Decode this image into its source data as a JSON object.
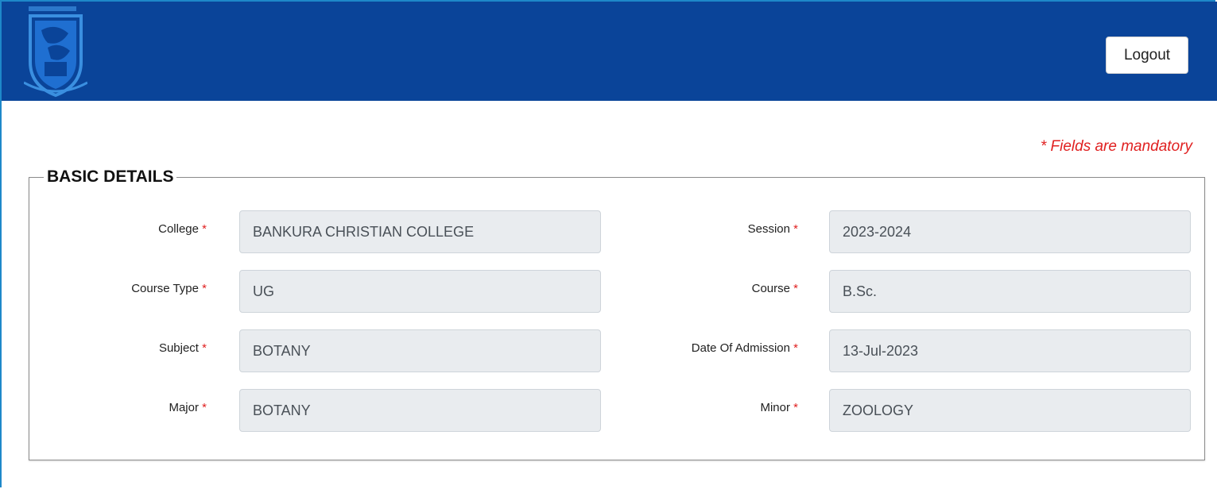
{
  "header": {
    "logout_label": "Logout",
    "bg_color": "#0a4499"
  },
  "mandatory_note": "* Fields are mandatory",
  "section": {
    "title": "BASIC DETAILS"
  },
  "fields": {
    "college": {
      "label": "College",
      "value": "BANKURA CHRISTIAN COLLEGE"
    },
    "session": {
      "label": "Session",
      "value": "2023-2024"
    },
    "course_type": {
      "label": "Course Type",
      "value": "UG"
    },
    "course": {
      "label": "Course",
      "value": "B.Sc."
    },
    "subject": {
      "label": "Subject",
      "value": "BOTANY"
    },
    "date_of_admission": {
      "label": "Date Of Admission",
      "value": "13-Jul-2023"
    },
    "major": {
      "label": "Major",
      "value": "BOTANY"
    },
    "minor": {
      "label": "Minor",
      "value": "ZOOLOGY"
    }
  },
  "required_marker": "*"
}
